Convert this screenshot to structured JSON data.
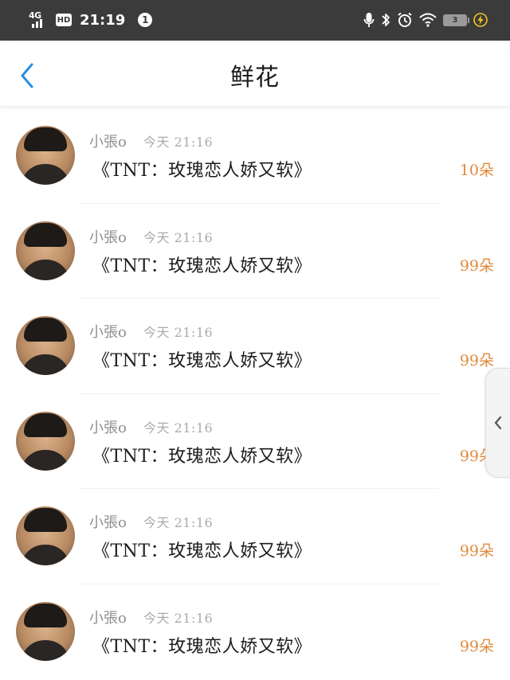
{
  "status_bar": {
    "network": "4G",
    "hd_badge": "HD",
    "time": "21:19",
    "notification_count": "1",
    "battery_level": "3",
    "icons": [
      "signal-icon",
      "microphone-icon",
      "bluetooth-icon",
      "alarm-icon",
      "wifi-icon",
      "battery-icon",
      "charging-icon"
    ]
  },
  "header": {
    "title": "鲜花",
    "back_icon": "chevron-left-icon"
  },
  "colors": {
    "status_bar_bg": "#3b3b3b",
    "accent_blue": "#2b8fde",
    "count_orange": "#e08a3c"
  },
  "gifts": [
    {
      "user": "小張o",
      "time": "今天  21:16",
      "gift": "《TNT：玫瑰恋人娇又软》",
      "count": "10朵"
    },
    {
      "user": "小張o",
      "time": "今天  21:16",
      "gift": "《TNT：玫瑰恋人娇又软》",
      "count": "99朵"
    },
    {
      "user": "小張o",
      "time": "今天  21:16",
      "gift": "《TNT：玫瑰恋人娇又软》",
      "count": "99朵"
    },
    {
      "user": "小張o",
      "time": "今天  21:16",
      "gift": "《TNT：玫瑰恋人娇又软》",
      "count": "99朵"
    },
    {
      "user": "小張o",
      "time": "今天  21:16",
      "gift": "《TNT：玫瑰恋人娇又软》",
      "count": "99朵"
    },
    {
      "user": "小張o",
      "time": "今天  21:16",
      "gift": "《TNT：玫瑰恋人娇又软》",
      "count": "99朵"
    }
  ],
  "side_handle": {
    "icon": "chevron-left-icon"
  }
}
